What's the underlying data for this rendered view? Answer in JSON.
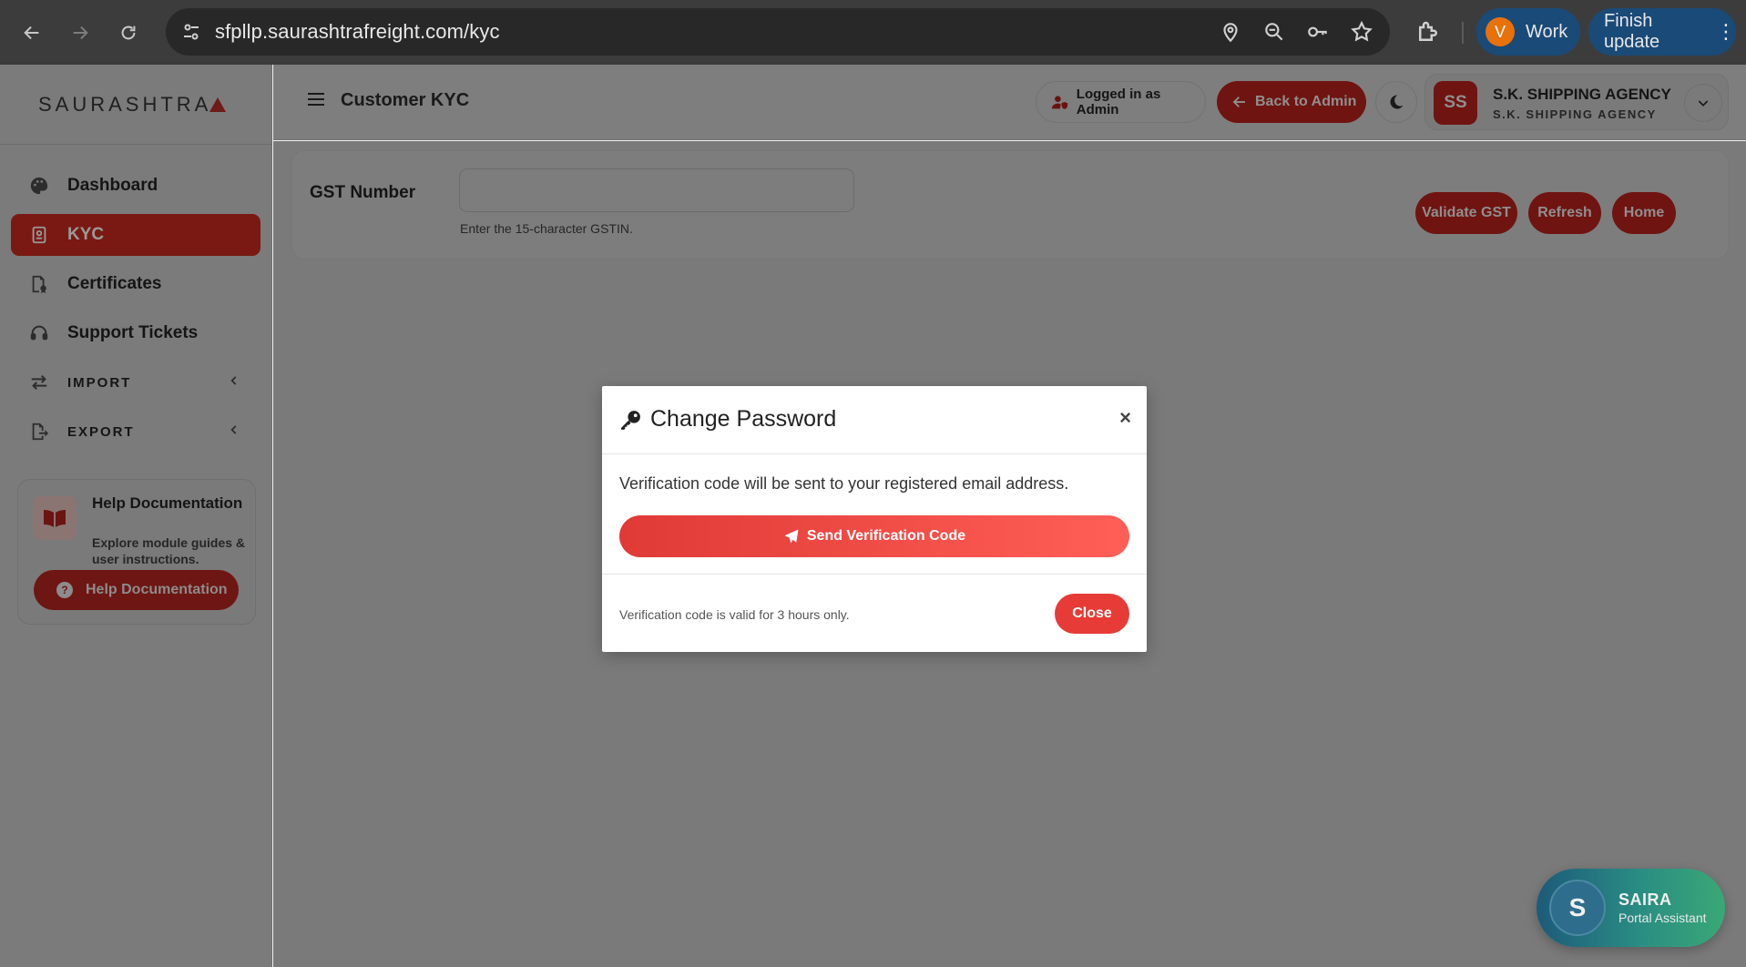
{
  "browser": {
    "url": "sfpllp.saurashtrafreight.com/kyc",
    "profile_initial": "V",
    "profile_label": "Work",
    "update_label": "Finish update"
  },
  "sidebar": {
    "brand": "SAURASHTRA",
    "items": [
      {
        "label": "Dashboard",
        "icon": "palette-icon"
      },
      {
        "label": "KYC",
        "icon": "id-card-icon",
        "active": true
      },
      {
        "label": "Certificates",
        "icon": "certificate-icon"
      },
      {
        "label": "Support Tickets",
        "icon": "headset-icon"
      },
      {
        "label": "IMPORT",
        "icon": "arrows-exchange-icon"
      },
      {
        "label": "EXPORT",
        "icon": "file-export-icon"
      }
    ],
    "help": {
      "title": "Help Documentation",
      "description": "Explore module guides & user instructions.",
      "button_label": "Help Documentation"
    }
  },
  "header": {
    "title": "Customer KYC",
    "logged_in": "Logged in as Admin",
    "back_label": "Back to Admin",
    "profile_initials": "SS",
    "profile_name": "S.K. SHIPPING AGENCY",
    "profile_sub": "S.K. SHIPPING AGENCY"
  },
  "gst": {
    "label": "GST Number",
    "value": "",
    "hint": "Enter the 15-character GSTIN.",
    "validate_label": "Validate GST",
    "refresh_label": "Refresh",
    "home_label": "Home"
  },
  "modal": {
    "title": "Change Password",
    "close_x": "×",
    "message": "Verification code will be sent to your registered email address.",
    "send_label": "Send Verification Code",
    "footer_note": "Verification code is valid for 3 hours only.",
    "close_label": "Close"
  },
  "assistant": {
    "initial": "S",
    "name": "SAIRA",
    "subtitle": "Portal Assistant"
  },
  "colors": {
    "brand_red": "#e63b36",
    "overlay_gray": "#7b7b7b",
    "assistant_teal": "#2a8d83"
  }
}
